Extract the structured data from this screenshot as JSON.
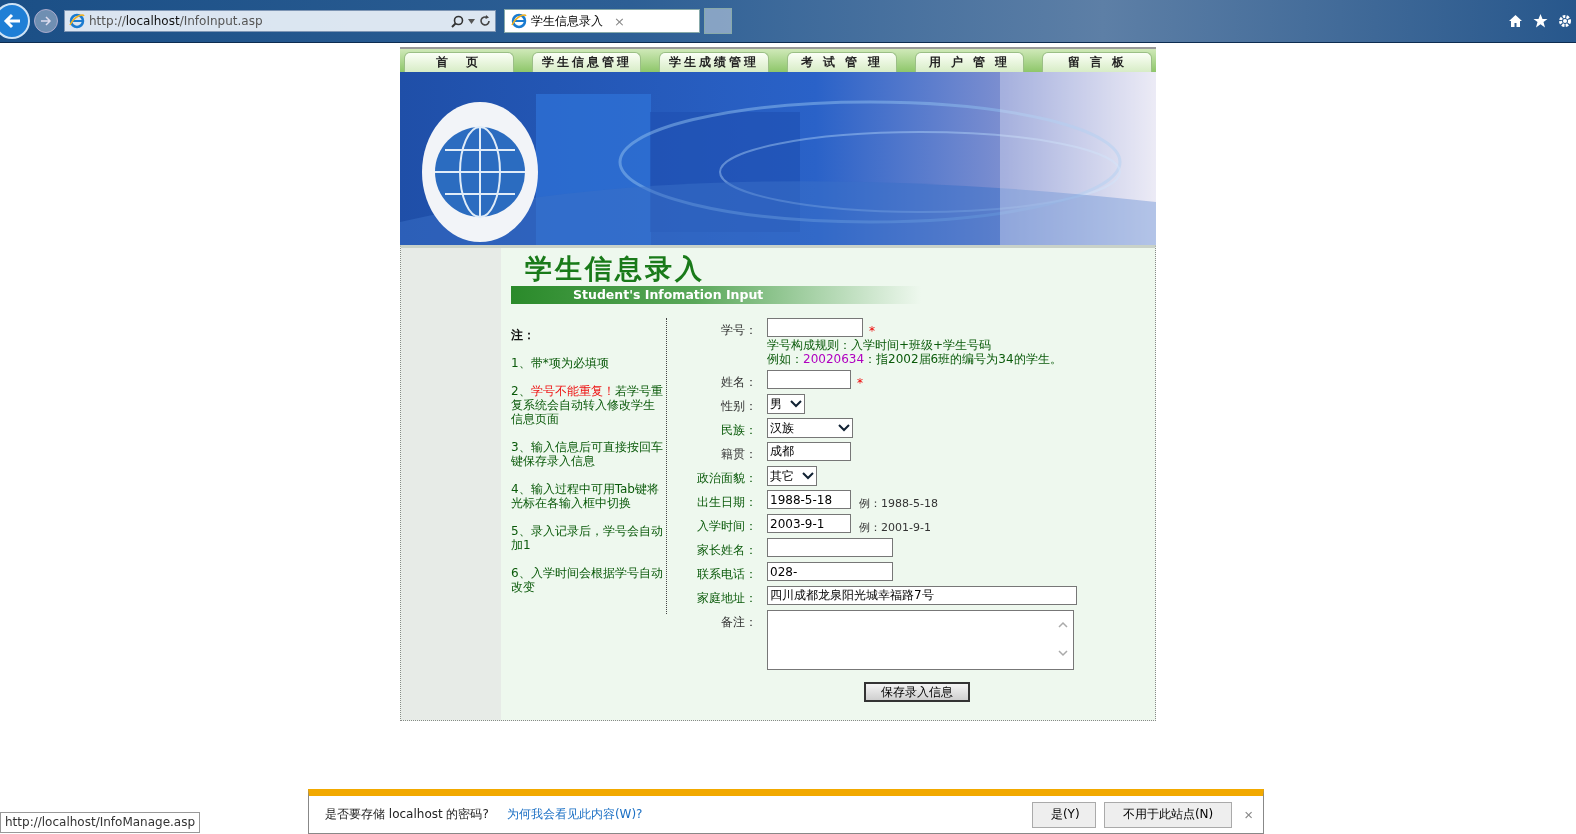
{
  "browser": {
    "url_host": "localhost",
    "url_prefix": "http://",
    "url_path": "/InfoInput.asp",
    "tab_title": "学生信息录入",
    "tab_close": "×"
  },
  "nav": [
    {
      "label": "首　页"
    },
    {
      "label": "学生信息管理"
    },
    {
      "label": "学生成绩管理"
    },
    {
      "label": "考 试 管 理"
    },
    {
      "label": "用 户 管 理"
    },
    {
      "label": "留 言 板"
    }
  ],
  "heading": {
    "title": "学生信息录入",
    "subtitle": "Student's Infomation Input"
  },
  "notes": {
    "title": "注：",
    "items": [
      {
        "prefix": "1、",
        "text": "带*项为必填项"
      },
      {
        "prefix": "2、",
        "alert": "学号不能重复！",
        "text": "若学号重复系统会自动转入修改学生信息页面"
      },
      {
        "prefix": "3、",
        "text": "输入信息后可直接按回车键保存录入信息"
      },
      {
        "prefix": "4、",
        "text": "输入过程中可用Tab键将光标在各输入框中切换"
      },
      {
        "prefix": "5、",
        "text": "录入记录后，学号会自动加1"
      },
      {
        "prefix": "6、",
        "text": "入学时间会根据学号自动改变"
      }
    ]
  },
  "form": {
    "fields": [
      {
        "kind": "text",
        "label": "学号：",
        "required": true,
        "rule": "学号构成规则：入学时间+班级+学生号码",
        "example_label": "例如：",
        "example_code": "20020634",
        "example_text": "：指2002届6班的编号为34的学生。"
      },
      {
        "kind": "text",
        "label": "姓名：",
        "required": true
      },
      {
        "kind": "select",
        "label": "性别：",
        "value": "男",
        "required": false
      },
      {
        "kind": "select",
        "label": "民族：",
        "value": "汉族",
        "required": false
      },
      {
        "kind": "text",
        "label": "籍贯：",
        "value": "成都",
        "required": false
      },
      {
        "kind": "select",
        "label": "政治面貌：",
        "value": "其它",
        "required": false
      },
      {
        "kind": "text",
        "label": "出生日期：",
        "value": "1988-5-18",
        "required": false,
        "example": "例：1988-5-18"
      },
      {
        "kind": "text",
        "label": "入学时间：",
        "value": "2003-9-1",
        "required": false,
        "example": "例：2001-9-1"
      },
      {
        "kind": "text",
        "label": "家长姓名：",
        "required": false
      },
      {
        "kind": "text",
        "label": "联系电话：",
        "value": "028-",
        "required": false
      },
      {
        "kind": "text",
        "label": "家庭地址：",
        "value": "四川成都龙泉阳光城幸福路7号",
        "required": false
      },
      {
        "kind": "textarea",
        "label": "备注：",
        "required": false
      }
    ],
    "required_mark": "*",
    "submit": "保存录入信息"
  },
  "password_bar": {
    "message": "是否要存储 localhost 的密码?",
    "link": "为何我会看见此内容(W)?",
    "buttons": [
      "是(Y)",
      "不用于此站点(N)"
    ],
    "close": "×"
  },
  "status_url": "http://localhost/InfoManage.asp"
}
